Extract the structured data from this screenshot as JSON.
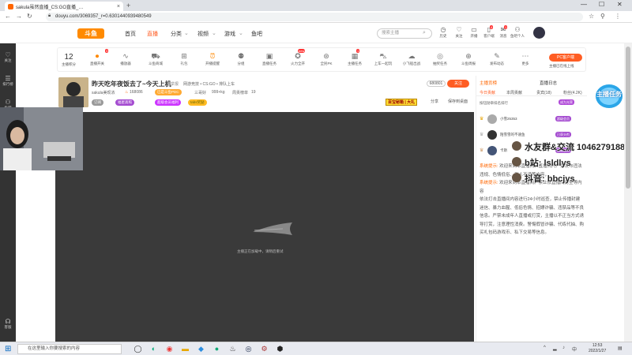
{
  "browser": {
    "tab_title": "sakula虽然直播_CS:GO直播_…",
    "url": "douyu.com/3069357_r=0.6301440939480549",
    "controls": {
      "minimize": "—",
      "maximize": "☐",
      "close": "✕"
    }
  },
  "header": {
    "logo": "斗鱼",
    "nav": [
      "首页",
      "直播",
      "分类",
      "视频",
      "游戏",
      "鱼吧"
    ],
    "active_nav": "直播",
    "search_placeholder": "搜索主播",
    "icons": [
      {
        "label": "历史",
        "icon": "clock-icon"
      },
      {
        "label": "关注",
        "icon": "heart-icon"
      },
      {
        "label": "开播",
        "icon": "camera-icon"
      },
      {
        "label": "客户端",
        "icon": "phone-icon"
      },
      {
        "label": "消息",
        "icon": "mail-icon"
      },
      {
        "label": "鱼吧个人",
        "icon": "fish-icon"
      }
    ],
    "badges": [
      "4",
      "1"
    ]
  },
  "left_rail": [
    {
      "label": "关注",
      "icon": "heart-icon"
    },
    {
      "label": "排行榜",
      "icon": "list-icon"
    },
    {
      "label": "鱼吧",
      "icon": "fish-icon"
    },
    {
      "label": "游戏",
      "icon": "game-icon"
    },
    {
      "label": "客服",
      "icon": "headset-icon"
    }
  ],
  "toolbar": {
    "level_number": "12",
    "level_label": "主播积分",
    "items": [
      {
        "label": "直播开关",
        "icon": "toggle-icon"
      },
      {
        "label": "播放器",
        "icon": "wave-icon"
      },
      {
        "label": "斗鱼商城",
        "icon": "cart-icon"
      },
      {
        "label": "礼包",
        "icon": "gift-icon"
      },
      {
        "label": "开播提醒",
        "icon": "alarm-icon"
      },
      {
        "label": "分组",
        "icon": "people-icon"
      },
      {
        "label": "直播任务",
        "icon": "ad-icon"
      },
      {
        "label": "火力全开",
        "icon": "fire-icon"
      },
      {
        "label": "全民PK",
        "icon": "vs-icon"
      },
      {
        "label": "主播任务",
        "icon": "calendar-icon"
      },
      {
        "label": "上车一起玩",
        "icon": "car-icon"
      },
      {
        "label": "小飞船出战",
        "icon": "cloud-icon"
      },
      {
        "label": "抽奖任务",
        "icon": "target-icon"
      },
      {
        "label": "斗鱼周报",
        "icon": "gamepad-icon"
      },
      {
        "label": "发布动态",
        "icon": "edit-icon"
      },
      {
        "label": "更多",
        "icon": "more-icon"
      }
    ],
    "badges": {
      "toggle": "3",
      "fire": "new",
      "calendar": "1"
    },
    "pc_button": "PC客户端",
    "pc_sub": "主播已在线上线"
  },
  "room": {
    "title": "昨天吃年夜饭去了~今天上机",
    "meta": [
      "举报",
      "网游竞技 • CS:GO • 排队上车"
    ],
    "streamer": "sakula美现浓",
    "hot": "168086",
    "tag_official": "已是斗鱼PDC",
    "subs_a": "三哥好",
    "subs_b": "999+kg",
    "week_rank": "周贡榜单",
    "week_value": "19",
    "chips": [
      "订阅",
      "福星高照",
      "超级会员福利",
      "tabs奖励"
    ],
    "room_id": "680801",
    "follow": "关注",
    "gift_btn": "百宝秘箱 | 大礼",
    "actions": [
      "分享",
      "保存到桌面"
    ],
    "avatar_label": "杂毛"
  },
  "video": {
    "loading_text": "主播正在加载中，请稍后重试"
  },
  "side_panel": {
    "header_left": "主播贡榜",
    "header_right": "直播日志",
    "tabs": [
      "今日贡献",
      "本周贡献",
      "贵宾(18)",
      "粉丝(4.2K)"
    ],
    "sub_header": "按钮勋章排名排行",
    "tab_badge": "成为光荣",
    "ranks": [
      {
        "name": "小雪25353",
        "badge": "超级会员",
        "crown": "♛"
      },
      {
        "name": "陌雪雪的不速鱼",
        "badge": "已获头衔",
        "crown": "♛"
      },
      {
        "name": "卡斯",
        "badge": "超级会员",
        "crown": "♛"
      }
    ],
    "chat": [
      {
        "sys": "系统提示:",
        "text": "欢迎来到本直播间，直播间内严禁发布违法违规、色情低俗、引人不适等内容，"
      },
      {
        "sys": "系统提示:",
        "text": "欢迎来到本直播间。禁止依直播间房型等内容"
      },
      {
        "sys": "",
        "text": "依法打击直播间内容进行24小时巡查，禁止传播封建迷信、暴力血腥、低俗色情、招嫖诈骗、违禁品等不良信息。严禁未成年人直播或打赏，主播以不正当方式诱导打赏，注意理性消费。警惕假冒诈骗、代练代抽、购买礼包码游戏币、私下交易等信息。"
      }
    ]
  },
  "overlay": {
    "qq_text": "水友群&交流 1046279188",
    "line2": "b站: lsldlys",
    "line3": "抖音: bbcjys",
    "banner": "主播任务"
  },
  "taskbar": {
    "search_placeholder": "在这里输入你要搜索的内容",
    "time": "12:53",
    "date": "2022/1/27",
    "apps": [
      "task-view-icon",
      "edge-icon",
      "chrome-icon",
      "folder-icon",
      "qq-icon",
      "media-icon",
      "steam-icon",
      "obs-icon",
      "game-icon",
      "csgo-icon"
    ]
  }
}
